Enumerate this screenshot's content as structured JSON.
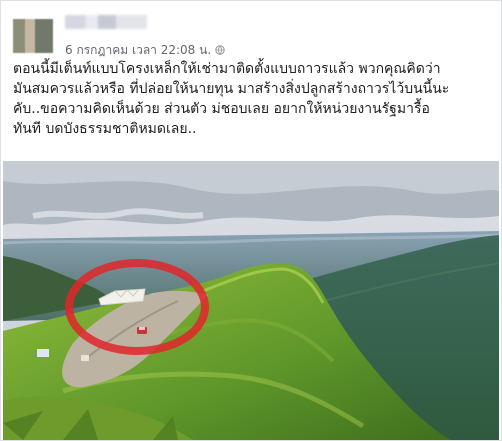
{
  "post": {
    "author_name": "",
    "timestamp": "6 กรกฎาคม เวลา 22:08 น.",
    "text_lines": [
      "ตอนนี้มีเต็นท์แบบโครงเหล็กให้เช่ามาติดตั้งแบบถาวรแล้ว พวกคุณคิดว่า",
      "มันสมควรแล้วหรือ ที่ปล่อยให้นายทุน มาสร้างสิ่งปลูกสร้างถาวรไว้บนนี้นะ",
      "คับ..ขอความคิดเห็นด้วย ส่วนตัว ม่ชอบเลย อยากให้หน่วยงานรัฐมารื้อ",
      "ทันที บดบังธรรมชาติหมดเลย.."
    ]
  },
  "photo": {
    "subject": "mountain-ridge-with-tents",
    "highlight_color": "#e0262a",
    "colors": {
      "sky_top": "#d9dde3",
      "cloud": "#b9c0c9",
      "valley": "#6c8a9a",
      "hill_green": "#5f9a2c",
      "grass_light": "#9cc33e",
      "road": "#bdb6a8",
      "tent": "#f1efe9",
      "car": "#c93434"
    }
  }
}
